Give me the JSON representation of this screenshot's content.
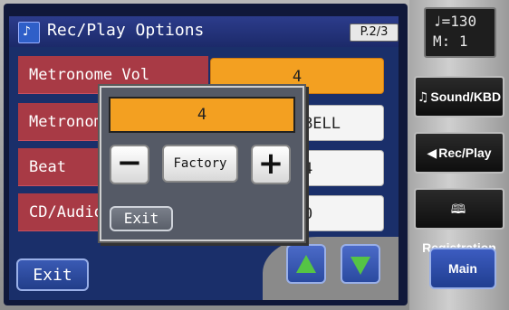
{
  "window": {
    "title": "Rec/Play Options",
    "page_indicator": "P.2/3",
    "title_icon": "music-note-icon"
  },
  "rows": [
    {
      "label": "Metronome Vol",
      "value": "4"
    },
    {
      "label": "Metronome Sound",
      "value": "BELL"
    },
    {
      "label": "Beat",
      "value": "4"
    },
    {
      "label": "CD/Audio",
      "value": "0"
    }
  ],
  "popup": {
    "value": "4",
    "minus_label": "−",
    "factory_label": "Factory",
    "plus_label": "+",
    "exit_label": "Exit"
  },
  "footer": {
    "exit_label": "Exit",
    "up_icon": "arrow-up-icon",
    "down_icon": "arrow-down-icon",
    "arrow_color": "#55c445"
  },
  "side": {
    "tempo_line": "♩=130",
    "measure_line": "M:  1",
    "buttons": [
      {
        "label": "Sound/KBD",
        "icon": "♫"
      },
      {
        "label": "Rec/Play",
        "icon": "◀"
      },
      {
        "label": "Registration",
        "icon": "🕮"
      }
    ],
    "main_label": "Main"
  },
  "colors": {
    "selected": "#f3a021",
    "row_label_bg": "#a83a45",
    "accent": "#2c3c8c"
  }
}
